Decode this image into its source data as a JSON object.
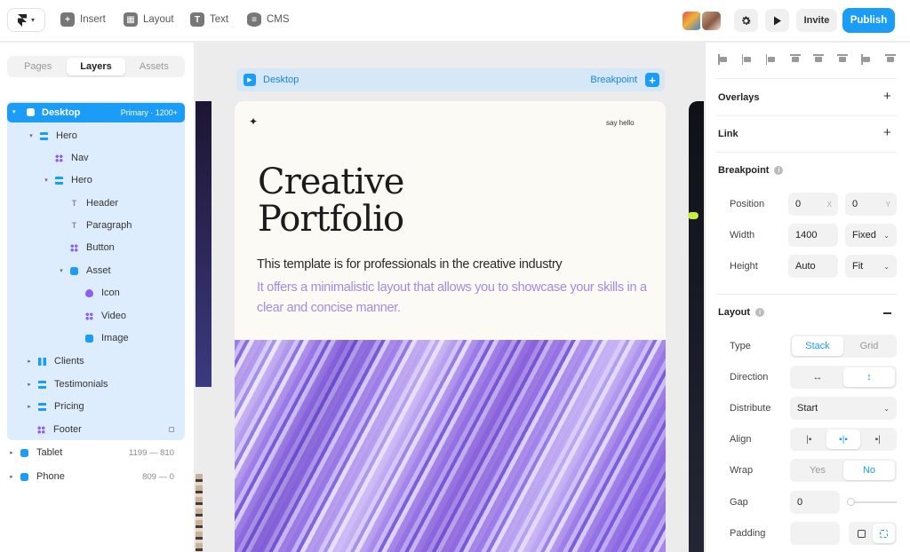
{
  "toolbar": {
    "insert": "Insert",
    "layout": "Layout",
    "text": "Text",
    "cms": "CMS",
    "invite": "Invite",
    "publish": "Publish",
    "icons": [
      "framer-logo-icon",
      "plus-box-icon",
      "layout-grid-icon",
      "text-icon",
      "database-icon",
      "gear-icon",
      "play-icon"
    ]
  },
  "left_panel": {
    "tabs": [
      "Pages",
      "Layers",
      "Assets"
    ],
    "active_tab": "Layers",
    "primary": {
      "label": "Desktop",
      "note": "Primary · 1200+"
    },
    "layers": [
      {
        "label": "Hero",
        "icon": "stack-icon"
      },
      {
        "label": "Nav",
        "icon": "component-icon"
      },
      {
        "label": "Hero",
        "icon": "stack-icon"
      },
      {
        "label": "Header",
        "icon": "text-icon"
      },
      {
        "label": "Paragraph",
        "icon": "text-icon"
      },
      {
        "label": "Button",
        "icon": "component-icon"
      },
      {
        "label": "Asset",
        "icon": "frame-icon"
      },
      {
        "label": "Icon",
        "icon": "drop-icon"
      },
      {
        "label": "Video",
        "icon": "component-icon"
      },
      {
        "label": "Image",
        "icon": "frame-icon"
      },
      {
        "label": "Clients",
        "icon": "columns-icon"
      },
      {
        "label": "Testimonials",
        "icon": "stack-icon"
      },
      {
        "label": "Pricing",
        "icon": "stack-icon"
      },
      {
        "label": "Footer",
        "icon": "component-icon"
      }
    ],
    "breakpoints": [
      {
        "label": "Tablet",
        "range": "1199 — 810"
      },
      {
        "label": "Phone",
        "range": "809 — 0"
      }
    ]
  },
  "canvas": {
    "frame_title": "Desktop",
    "breakpoint_label": "Breakpoint",
    "page": {
      "say_hello": "say hello",
      "title_line1": "Creative",
      "title_line2": "Portfolio",
      "lead": "This template is for professionals in the creative industry",
      "sub": "It offers a minimalistic layout that allows you to showcase your skills in a clear and concise manner."
    }
  },
  "right_panel": {
    "overlays": "Overlays",
    "link": "Link",
    "breakpoint": {
      "title": "Breakpoint",
      "position_label": "Position",
      "x": "0",
      "x_unit": "X",
      "y": "0",
      "y_unit": "Y",
      "width_label": "Width",
      "width": "1400",
      "width_mode": "Fixed",
      "height_label": "Height",
      "height": "Auto",
      "height_mode": "Fit"
    },
    "layout": {
      "title": "Layout",
      "type_label": "Type",
      "type_options": [
        "Stack",
        "Grid"
      ],
      "type_selected": "Stack",
      "direction_label": "Direction",
      "direction_options": [
        "↔",
        "↕"
      ],
      "direction_selected": "↕",
      "distribute_label": "Distribute",
      "distribute": "Start",
      "align_label": "Align",
      "wrap_label": "Wrap",
      "wrap_options": [
        "Yes",
        "No"
      ],
      "wrap_selected": "No",
      "gap_label": "Gap",
      "gap": "0",
      "padding_label": "Padding"
    }
  },
  "colors": {
    "accent": "#1a9cf7",
    "purple_text": "#a18ce5",
    "selection_bg": "#deedfd"
  }
}
